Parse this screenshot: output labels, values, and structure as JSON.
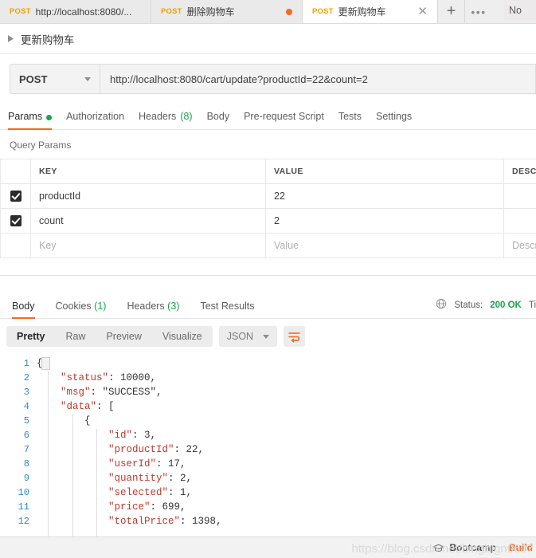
{
  "tabbar": {
    "tabs": [
      {
        "method": "POST",
        "name": "http://localhost:8080/...",
        "state": "inactive",
        "marker": "none"
      },
      {
        "method": "POST",
        "name": "删除购物车",
        "state": "inactive",
        "marker": "unsaved-dot"
      },
      {
        "method": "POST",
        "name": "更新购物车",
        "state": "active",
        "marker": "close"
      }
    ],
    "new_tab_icon": "plus-icon",
    "more_icon": "ellipsis-icon",
    "environment_selector": "No"
  },
  "breadcrumb": {
    "caret_icon": "chevron-right-icon",
    "title": "更新购物车"
  },
  "request": {
    "method": "POST",
    "method_caret_icon": "chevron-down-icon",
    "url": "http://localhost:8080/cart/update?productId=22&count=2",
    "tabs": [
      {
        "label": "Params",
        "badge": "",
        "dot": true,
        "active": true
      },
      {
        "label": "Authorization",
        "badge": "",
        "dot": false,
        "active": false
      },
      {
        "label": "Headers",
        "badge": "(8)",
        "dot": false,
        "active": false
      },
      {
        "label": "Body",
        "badge": "",
        "dot": false,
        "active": false
      },
      {
        "label": "Pre-request Script",
        "badge": "",
        "dot": false,
        "active": false
      },
      {
        "label": "Tests",
        "badge": "",
        "dot": false,
        "active": false
      },
      {
        "label": "Settings",
        "badge": "",
        "dot": false,
        "active": false
      }
    ]
  },
  "query_params": {
    "section_label": "Query Params",
    "columns": [
      "KEY",
      "VALUE",
      "DESCRI"
    ],
    "rows": [
      {
        "checked": true,
        "key": "productId",
        "value": "22",
        "description": ""
      },
      {
        "checked": true,
        "key": "count",
        "value": "2",
        "description": ""
      }
    ],
    "placeholder_row": {
      "key": "Key",
      "value": "Value",
      "description": "Descri"
    }
  },
  "response": {
    "tabs": [
      {
        "label": "Body",
        "badge": "",
        "active": true
      },
      {
        "label": "Cookies",
        "badge": "(1)",
        "active": false
      },
      {
        "label": "Headers",
        "badge": "(3)",
        "active": false
      },
      {
        "label": "Test Results",
        "badge": "",
        "active": false
      }
    ],
    "globe_icon": "globe-icon",
    "status_label": "Status:",
    "status_value": "200 OK",
    "time_label": "Ti",
    "view_modes": [
      {
        "label": "Pretty",
        "active": true
      },
      {
        "label": "Raw",
        "active": false
      },
      {
        "label": "Preview",
        "active": false
      },
      {
        "label": "Visualize",
        "active": false
      }
    ],
    "format": "JSON",
    "format_caret_icon": "chevron-down-icon",
    "wrap_icon": "wrap-lines-icon",
    "body_lines": [
      {
        "no": "1",
        "indent": 0,
        "text": "{"
      },
      {
        "no": "2",
        "indent": 1,
        "text": "\"status\": 10000,"
      },
      {
        "no": "3",
        "indent": 1,
        "text": "\"msg\": \"SUCCESS\","
      },
      {
        "no": "4",
        "indent": 1,
        "text": "\"data\": ["
      },
      {
        "no": "5",
        "indent": 2,
        "text": "{"
      },
      {
        "no": "6",
        "indent": 3,
        "text": "\"id\": 3,"
      },
      {
        "no": "7",
        "indent": 3,
        "text": "\"productId\": 22,"
      },
      {
        "no": "8",
        "indent": 3,
        "text": "\"userId\": 17,"
      },
      {
        "no": "9",
        "indent": 3,
        "text": "\"quantity\": 2,"
      },
      {
        "no": "10",
        "indent": 3,
        "text": "\"selected\": 1,"
      },
      {
        "no": "11",
        "indent": 3,
        "text": "\"price\": 699,"
      },
      {
        "no": "12",
        "indent": 3,
        "text": "\"totalPrice\": 1398,"
      }
    ]
  },
  "statusbar": {
    "bootcamp_icon": "graduation-cap-icon",
    "bootcamp_label": "Bootcamp",
    "build_label": "Build"
  },
  "watermark": {
    "text": "https://blog.csdn.net/bingbign0607"
  }
}
